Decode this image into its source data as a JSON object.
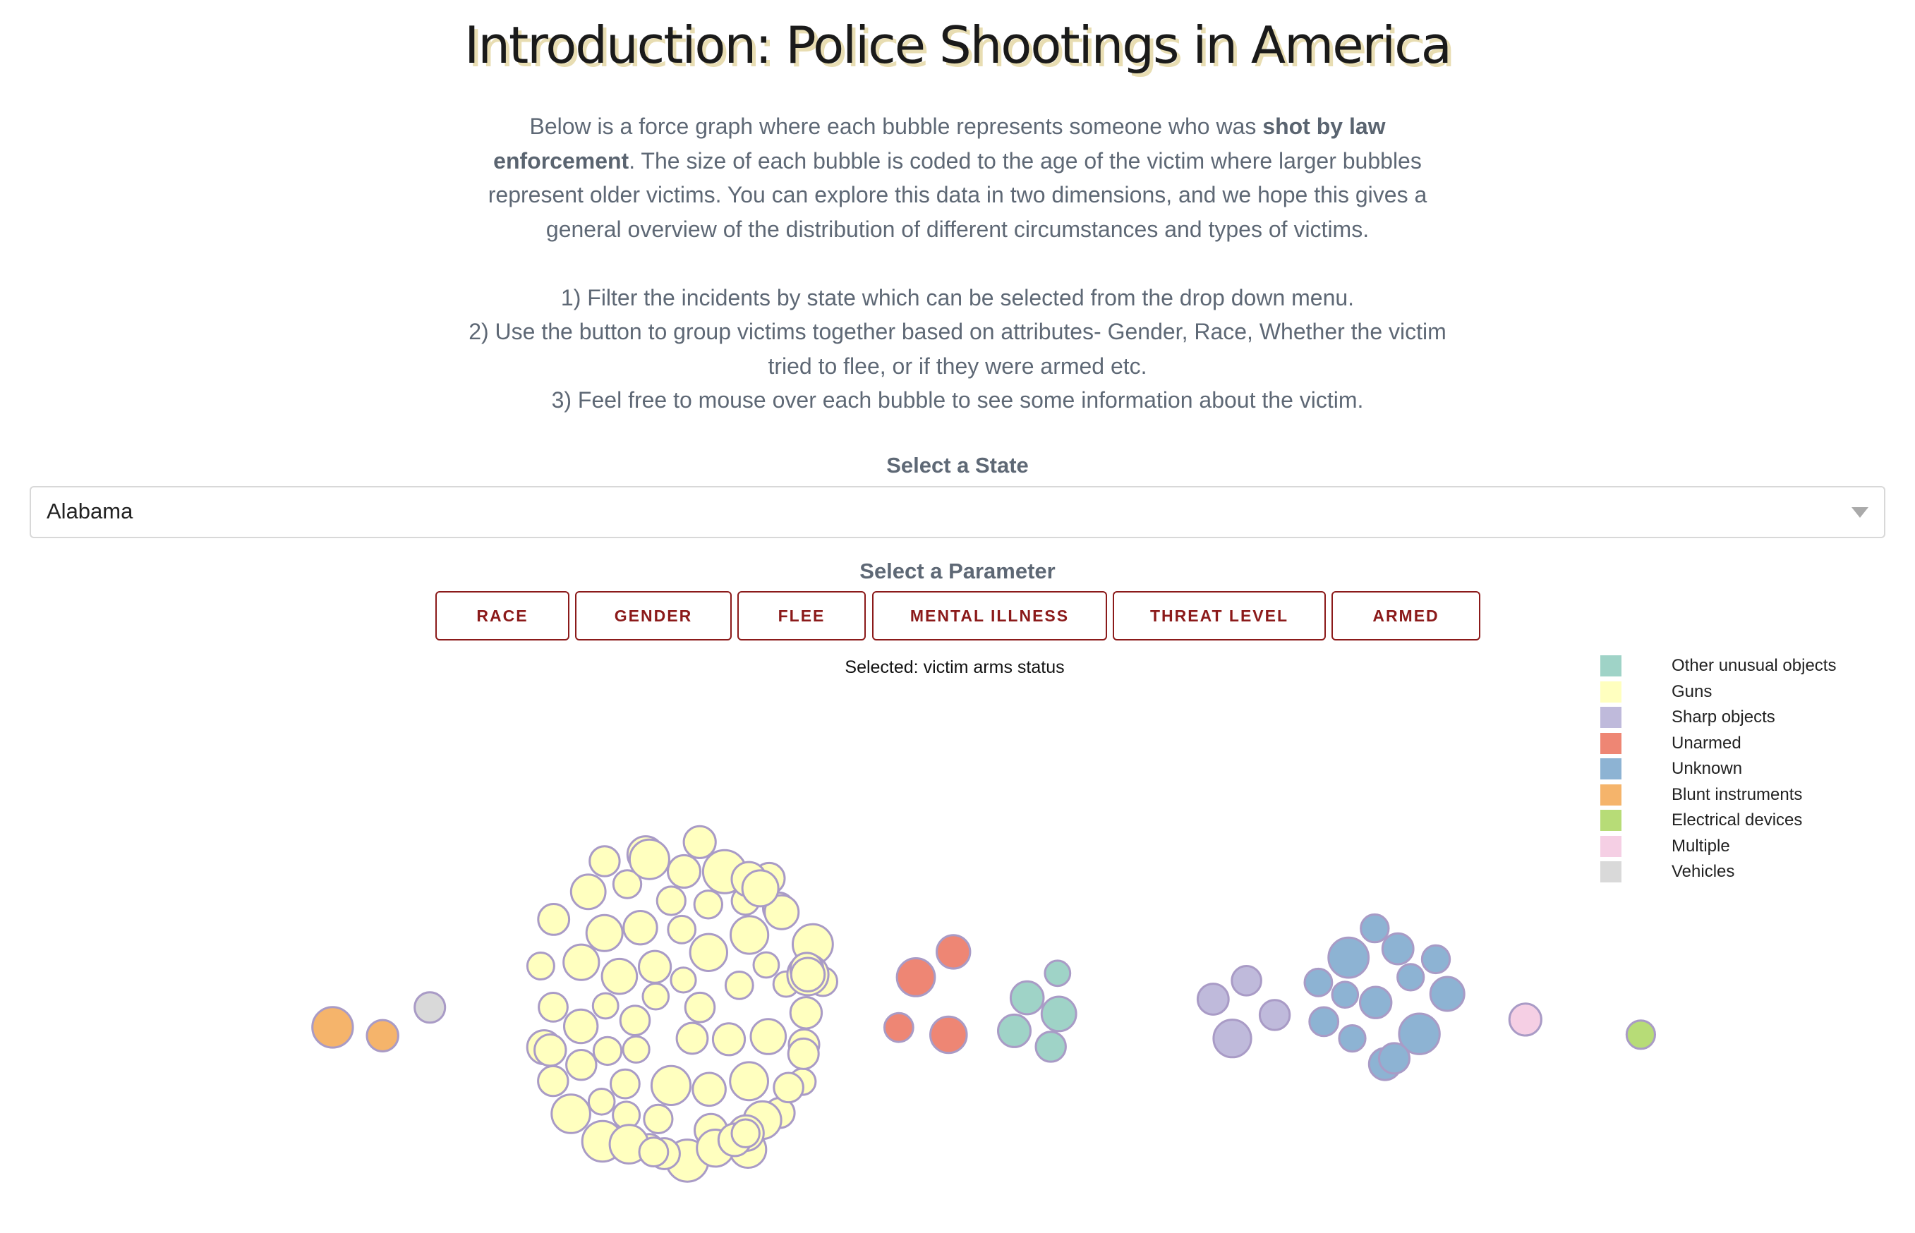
{
  "title": "Introduction: Police Shootings in America",
  "intro": {
    "p1_before": "Below is a force graph where each bubble represents someone who was ",
    "p1_bold": "shot by law enforcement",
    "p1_after": ". The size of each bubble is coded to the age of the victim where larger bubbles represent older victims. You can explore this data in two dimensions, and we hope this gives a general overview of the distribution of different circumstances and types of victims.",
    "step1": "1) Filter the incidents by state which can be selected from the drop down menu.",
    "step2": "2) Use the button to group victims together based on attributes- Gender, Race, Whether the victim tried to flee, or if they were armed etc.",
    "step3": "3) Feel free to mouse over each bubble to see some information about the victim."
  },
  "state_select": {
    "label": "Select a State",
    "value": "Alabama"
  },
  "parameter": {
    "label": "Select a Parameter",
    "buttons": [
      "RACE",
      "GENDER",
      "FLEE",
      "MENTAL ILLNESS",
      "THREAT LEVEL",
      "ARMED"
    ],
    "selected_text": "Selected: victim arms status"
  },
  "colors": {
    "button_text": "#8b1a1a",
    "bubble_stroke": "#a99bc6"
  },
  "chart_data": {
    "type": "scatter",
    "description_encoding": "bubble size = victim age; color and cluster = armed status",
    "legend": [
      {
        "name": "Other unusual objects",
        "color": "#9fd3c7"
      },
      {
        "name": "Guns",
        "color": "#ffffbf"
      },
      {
        "name": "Sharp objects",
        "color": "#bfbadb"
      },
      {
        "name": "Unarmed",
        "color": "#ee8674"
      },
      {
        "name": "Unknown",
        "color": "#8db3d3"
      },
      {
        "name": "Blunt instruments",
        "color": "#f5b46b"
      },
      {
        "name": "Electrical devices",
        "color": "#b7dc77"
      },
      {
        "name": "Multiple",
        "color": "#f5cfe4"
      },
      {
        "name": "Vehicles",
        "color": "#d9d9d9"
      }
    ],
    "legend_placement": "top-right",
    "cluster_order": [
      "Blunt instruments",
      "Vehicles",
      "Guns",
      "Unarmed",
      "Other unusual objects",
      "Sharp objects",
      "Unknown",
      "Multiple",
      "Electrical devices"
    ],
    "groups": [
      {
        "name": "Blunt instruments",
        "count": 2,
        "ages": [
          52,
          34
        ]
      },
      {
        "name": "Vehicles",
        "count": 1,
        "ages": [
          32
        ]
      },
      {
        "name": "Guns",
        "count": 77,
        "ages": [
          28,
          35,
          22,
          42,
          33,
          51,
          47,
          26,
          31,
          38,
          44,
          29,
          24,
          55,
          36,
          30,
          41,
          27,
          49,
          33,
          23,
          39,
          45,
          28,
          34,
          52,
          37,
          25,
          31,
          46,
          29,
          40,
          22,
          35,
          48,
          27,
          33,
          43,
          30,
          26,
          57,
          32,
          38,
          24,
          44,
          29,
          36,
          41,
          21,
          50,
          34,
          27,
          39,
          31,
          46,
          23,
          35,
          42,
          28,
          53,
          33,
          25,
          37,
          30,
          45,
          26,
          40,
          32,
          22,
          48,
          36,
          29,
          43,
          27,
          34,
          38,
          31
        ]
      },
      {
        "name": "Unarmed",
        "count": 4,
        "ages": [
          29,
          44,
          47,
          38
        ]
      },
      {
        "name": "Other unusual objects",
        "count": 5,
        "ages": [
          37,
          31,
          40,
          22,
          36
        ]
      },
      {
        "name": "Sharp objects",
        "count": 4,
        "ages": [
          31,
          33,
          46,
          30
        ]
      },
      {
        "name": "Unknown",
        "count": 14,
        "ages": [
          52,
          33,
          24,
          23,
          34,
          39,
          51,
          35,
          24,
          27,
          29,
          27,
          26,
          32
        ]
      },
      {
        "name": "Multiple",
        "count": 1,
        "ages": [
          35
        ]
      },
      {
        "name": "Electrical devices",
        "count": 1,
        "ages": [
          28
        ]
      }
    ]
  }
}
